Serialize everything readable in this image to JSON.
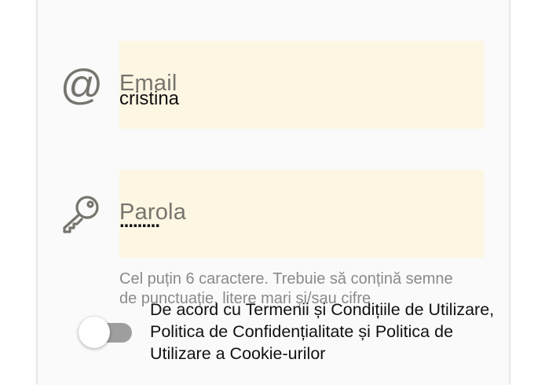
{
  "form": {
    "email": {
      "icon": "at-sign-icon",
      "label": "Email",
      "value": "cristina"
    },
    "password": {
      "icon": "key-icon",
      "label": "Parola",
      "value": "........."
    },
    "password_hint": "Cel puțin 6 caractere. Trebuie să conțină semne de punctuație, litere mari și/sau cifre",
    "terms": {
      "toggle_on": false,
      "text": "De acord cu Termenii și Condițiile de Utilizare, Politica de Confidențialitate și Politica de Utilizare a Cookie-urilor"
    }
  },
  "colors": {
    "field_background": "#fdf6e3",
    "icon": "#76746d",
    "card_background": "#fafafa",
    "toggle_track": "#9e9e9e"
  }
}
